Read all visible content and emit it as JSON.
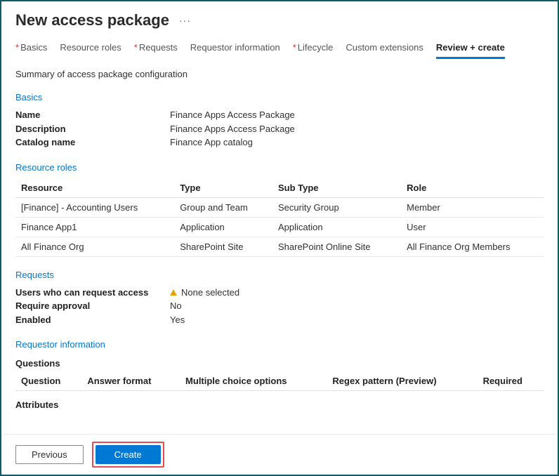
{
  "header": {
    "title": "New access package",
    "more": "···"
  },
  "tabs": [
    {
      "label": "Basics",
      "required": true,
      "active": false
    },
    {
      "label": "Resource roles",
      "required": false,
      "active": false
    },
    {
      "label": "Requests",
      "required": true,
      "active": false
    },
    {
      "label": "Requestor information",
      "required": false,
      "active": false
    },
    {
      "label": "Lifecycle",
      "required": true,
      "active": false
    },
    {
      "label": "Custom extensions",
      "required": false,
      "active": false
    },
    {
      "label": "Review + create",
      "required": false,
      "active": true
    }
  ],
  "summary_label": "Summary of access package configuration",
  "section_headings": {
    "basics": "Basics",
    "resource_roles": "Resource roles",
    "requests": "Requests",
    "requestor_info": "Requestor information"
  },
  "basics": {
    "fields": [
      {
        "k": "Name",
        "v": "Finance Apps Access Package"
      },
      {
        "k": "Description",
        "v": "Finance Apps Access Package"
      },
      {
        "k": "Catalog name",
        "v": "Finance App catalog"
      }
    ]
  },
  "resource_roles": {
    "headers": [
      "Resource",
      "Type",
      "Sub Type",
      "Role"
    ],
    "rows": [
      [
        "[Finance] - Accounting Users",
        "Group and Team",
        "Security Group",
        "Member"
      ],
      [
        "Finance App1",
        "Application",
        "Application",
        "User"
      ],
      [
        "All Finance Org",
        "SharePoint Site",
        "SharePoint Online Site",
        "All Finance Org Members"
      ]
    ]
  },
  "requests": {
    "fields": [
      {
        "k": "Users who can request access",
        "v": "None selected",
        "warn": true
      },
      {
        "k": "Require approval",
        "v": "No",
        "warn": false
      },
      {
        "k": "Enabled",
        "v": "Yes",
        "warn": false
      }
    ]
  },
  "requestor_info": {
    "questions_label": "Questions",
    "question_headers": [
      "Question",
      "Answer format",
      "Multiple choice options",
      "Regex pattern (Preview)",
      "Required"
    ],
    "attributes_label": "Attributes"
  },
  "footer": {
    "previous": "Previous",
    "create": "Create"
  }
}
